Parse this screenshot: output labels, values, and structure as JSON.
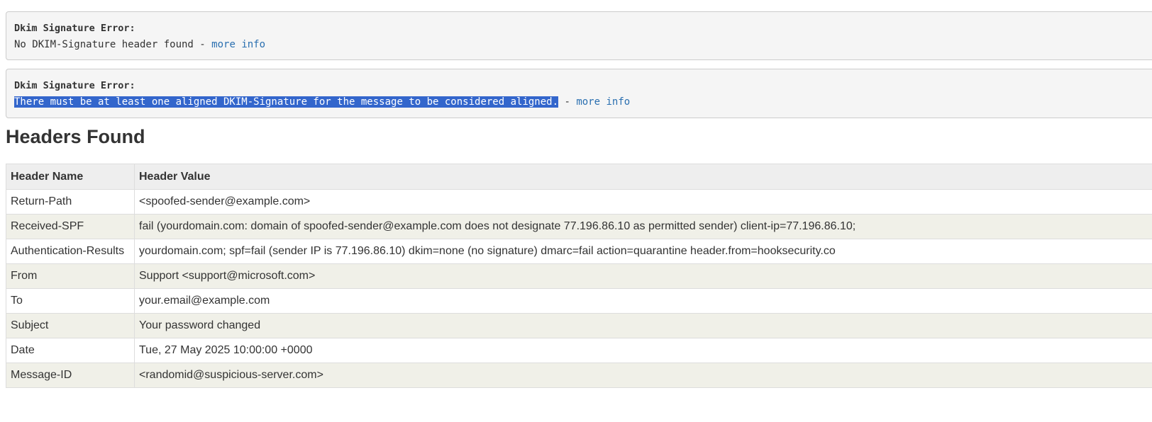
{
  "errors": [
    {
      "title": "Dkim Signature Error:",
      "message": "No DKIM-Signature header found",
      "separator": " - ",
      "link": "more info"
    },
    {
      "title": "Dkim Signature Error:",
      "message": "There must be at least one aligned DKIM-Signature for the message to be considered aligned.",
      "separator": " - ",
      "link": "more info",
      "message_selected": true
    }
  ],
  "section_title": "Headers Found",
  "table": {
    "columns": [
      "Header Name",
      "Header Value"
    ],
    "rows": [
      {
        "name": "Return-Path",
        "value": "<spoofed-sender@example.com>"
      },
      {
        "name": "Received-SPF",
        "value": "fail (yourdomain.com: domain of spoofed-sender@example.com does not designate 77.196.86.10 as permitted sender) client-ip=77.196.86.10;"
      },
      {
        "name": "Authentication-Results",
        "value": "yourdomain.com; spf=fail (sender IP is 77.196.86.10) dkim=none (no signature) dmarc=fail action=quarantine header.from=hooksecurity.co"
      },
      {
        "name": "From",
        "value": "Support <support@microsoft.com>"
      },
      {
        "name": "To",
        "value": "your.email@example.com"
      },
      {
        "name": "Subject",
        "value": "Your password changed"
      },
      {
        "name": "Date",
        "value": "Tue, 27 May 2025 10:00:00 +0000"
      },
      {
        "name": "Message-ID",
        "value": "<randomid@suspicious-server.com>"
      }
    ]
  },
  "colors": {
    "link": "#2a6fb0",
    "selection": "#3366cc",
    "box_bg": "#f5f5f5",
    "row_alt": "#f0f0e8"
  }
}
